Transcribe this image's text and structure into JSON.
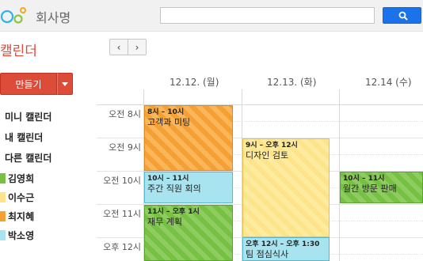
{
  "header": {
    "company_name": "회사명",
    "search_placeholder": "",
    "search_button_icon": "magnifier-icon",
    "accent_color": "#1a73e8"
  },
  "page_title": "캘린더",
  "nav": {
    "prev": "‹",
    "next": "›"
  },
  "create": {
    "label": "만들기",
    "color": "#dd4b39"
  },
  "sidebar": {
    "items": [
      "미니 캘린더",
      "내 캘린더",
      "다른 캘린더"
    ],
    "people": [
      {
        "name": "김영희",
        "color": "#76c043"
      },
      {
        "name": "이수근",
        "color": "#fde48a"
      },
      {
        "name": "최지혜",
        "color": "#f6a034"
      },
      {
        "name": "박소영",
        "color": "#a8e4ef"
      }
    ]
  },
  "days": [
    "12.12. (월)",
    "12.13. (화)",
    "12.14 (수)"
  ],
  "times": [
    "오전 8시",
    "오전 9시",
    "오전 10시",
    "오전 11시",
    "오후 12시"
  ],
  "events": [
    {
      "time": "8시 – 10시",
      "title": "고객과 미팅"
    },
    {
      "time": "9시 – 오후 12시",
      "title": "디자인 검토"
    },
    {
      "time": "10시 – 11시",
      "title": "주간 직원 회의"
    },
    {
      "time": "10시 – 11시",
      "title": "월간 방문 판매"
    },
    {
      "time": "11시 – 오후 1시",
      "title": "재무 계획"
    },
    {
      "time": "오후 12시 – 오후 1:30",
      "title": "팀 점심식사"
    }
  ]
}
